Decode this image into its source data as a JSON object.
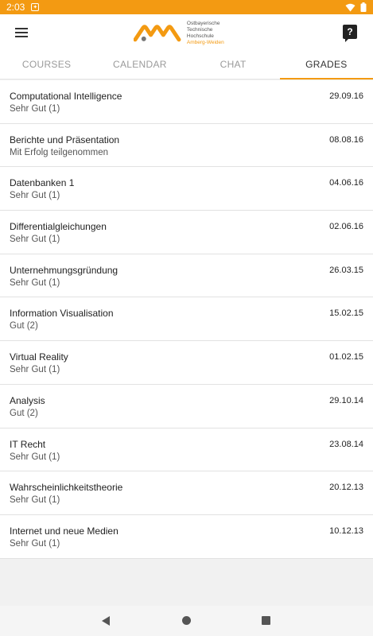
{
  "status_bar": {
    "time": "2:03",
    "notification_icon": "notification-icon",
    "wifi_icon": "wifi-icon",
    "battery_icon": "battery-icon"
  },
  "app_bar": {
    "menu_icon": "hamburger-menu-icon",
    "logo": {
      "line1": "Ostbayerische",
      "line2": "Technische Hochschule",
      "line3": "Amberg-Weiden",
      "brand_color": "#f39a12"
    },
    "help_label": "?"
  },
  "tabs": [
    {
      "label": "COURSES"
    },
    {
      "label": "CALENDAR"
    },
    {
      "label": "CHAT"
    },
    {
      "label": "GRADES",
      "active": true
    }
  ],
  "grades": [
    {
      "course": "Computational Intelligence",
      "grade": "Sehr Gut (1)",
      "date": "29.09.16"
    },
    {
      "course": "Berichte und Präsentation",
      "grade": "Mit Erfolg teilgenommen",
      "date": "08.08.16"
    },
    {
      "course": "Datenbanken 1",
      "grade": "Sehr Gut (1)",
      "date": "04.06.16"
    },
    {
      "course": "Differentialgleichungen",
      "grade": "Sehr Gut (1)",
      "date": "02.06.16"
    },
    {
      "course": "Unternehmungsgründung",
      "grade": "Sehr Gut (1)",
      "date": "26.03.15"
    },
    {
      "course": "Information Visualisation",
      "grade": "Gut (2)",
      "date": "15.02.15"
    },
    {
      "course": "Virtual Reality",
      "grade": "Sehr Gut (1)",
      "date": "01.02.15"
    },
    {
      "course": "Analysis",
      "grade": "Gut (2)",
      "date": "29.10.14"
    },
    {
      "course": "IT Recht",
      "grade": "Sehr Gut (1)",
      "date": "23.08.14"
    },
    {
      "course": "Wahrscheinlichkeitstheorie",
      "grade": "Sehr Gut (1)",
      "date": "20.12.13"
    },
    {
      "course": "Internet und neue Medien",
      "grade": "Sehr Gut (1)",
      "date": "10.12.13"
    }
  ],
  "colors": {
    "accent": "#f39a12",
    "status_bar": "#f39a12",
    "background": "#f1f1f1"
  }
}
